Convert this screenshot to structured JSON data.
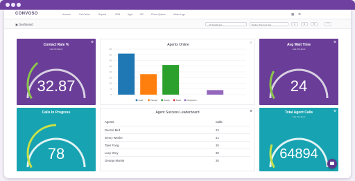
{
  "app": {
    "logo": "CONVOSO",
    "nav": [
      "Account",
      "Call Center",
      "Reports",
      "CRM",
      "Apps",
      "API",
      "Phone System",
      "Admin Logs"
    ],
    "page_title": "Dashboard",
    "dashboard_select": "-- My Dashboard --",
    "timeframe_select": "Medium Title Font Size",
    "toolbar_buttons": [
      "▾",
      "⬆",
      "☰",
      "+"
    ]
  },
  "colors": {
    "purple": "#6a3d98",
    "teal": "#17a3b1",
    "gauge_arc": "#8ac54a",
    "gauge_track": "#d8d0e2"
  },
  "widgets": {
    "contact_rate": {
      "title": "Contact Rate %",
      "subtitle": "Last 24 Hours",
      "value": "32.87",
      "level": 0.33
    },
    "avg_wait": {
      "title": "Avg Wait Time",
      "subtitle": "Last 24 Hours",
      "value": "24",
      "level": 0.24
    },
    "calls_in_progress": {
      "title": "Calls In Progress",
      "subtitle": "",
      "value": "78",
      "level": 0.5
    },
    "total_agent_calls": {
      "title": "Total Agent Calls",
      "subtitle": "Last 24 Hours",
      "value": "64894",
      "level": 0.2
    }
  },
  "chart_data": {
    "type": "bar",
    "title": "Agents Online",
    "ylim": [
      0,
      40
    ],
    "yticks": [
      0,
      5,
      10,
      15,
      20,
      25,
      30,
      35,
      40
    ],
    "menu_label": "≡",
    "series": [
      {
        "name": "Avail",
        "color": "#1f77b4",
        "values": [
          36,
          0,
          0,
          0,
          0
        ]
      },
      {
        "name": "Paused",
        "color": "#ff7f0e",
        "values": [
          0,
          18,
          0,
          0,
          0
        ]
      },
      {
        "name": "Ready",
        "color": "#2ca02c",
        "values": [
          0,
          0,
          26,
          0,
          0
        ]
      },
      {
        "name": "Dead",
        "color": "#d62728",
        "values": [
          0,
          0,
          0,
          0,
          0
        ]
      },
      {
        "name": "Dispositon",
        "color": "#9467bd",
        "values": [
          0,
          0,
          0,
          0,
          4
        ]
      }
    ],
    "grid": true,
    "legend": "bottom"
  },
  "leaderboard": {
    "title": "Agent Success Leaderboard",
    "columns": [
      "Agents",
      "Calls"
    ],
    "rows": [
      [
        "Denzel Bird",
        "22"
      ],
      [
        "Jenny Wesler",
        "21"
      ],
      [
        "Tyler Fong",
        "20"
      ],
      [
        "Lucy Grey",
        "20"
      ],
      [
        "George Mursie",
        "20"
      ]
    ]
  }
}
